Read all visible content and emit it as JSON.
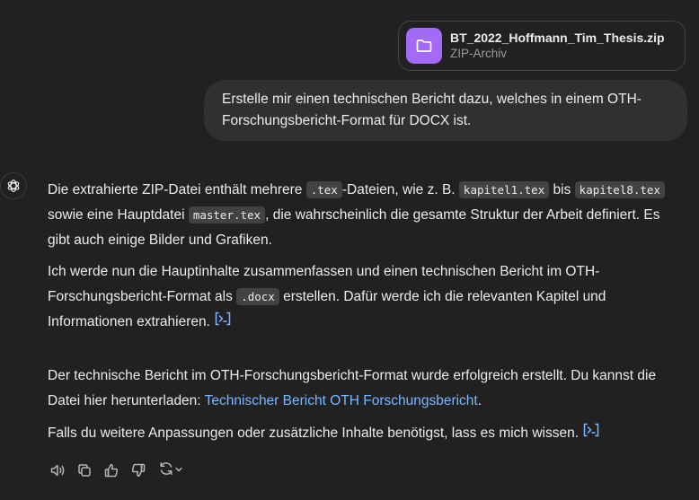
{
  "attachment": {
    "file_name": "BT_2022_Hoffmann_Tim_Thesis.zip",
    "file_type": "ZIP-Archiv"
  },
  "user_message": {
    "line1": "Erstelle mir einen technischen Bericht dazu, welches in einem OTH-",
    "line2": "Forschungsbericht-Format für DOCX ist."
  },
  "assistant": {
    "p1": {
      "t1": "Die extrahierte ZIP-Datei enthält mehrere ",
      "c1": ".tex",
      "t2": "-Dateien, wie z. B. ",
      "c2": "kapitel1.tex",
      "t3": " bis ",
      "c3": "kapitel8.tex",
      "t4": "sowie eine Hauptdatei ",
      "c4": "master.tex",
      "t5": ", die wahrscheinlich die gesamte Struktur der Arbeit definiert. Es",
      "t6": "gibt auch einige Bilder und Grafiken."
    },
    "p2": {
      "t1": "Ich werde nun die Hauptinhalte zusammenfassen und einen technischen Bericht im OTH-",
      "t2": "Forschungsbericht-Format als ",
      "c1": ".docx",
      "t3": " erstellen. Dafür werde ich die relevanten Kapitel und",
      "t4": "Informationen extrahieren."
    },
    "p3": {
      "t1": "Der technische Bericht im OTH-Forschungsbericht-Format wurde erfolgreich erstellt. Du kannst die",
      "t2": "Datei hier herunterladen: ",
      "link": "Technischer Bericht OTH Forschungsbericht",
      "t3": "."
    },
    "p4": {
      "t1": "Falls du weitere Anpassungen oder zusätzliche Inhalte benötigst, lass es mich wissen."
    }
  },
  "icons": {
    "attachment": "folder-icon",
    "avatar": "chatgpt-logo-icon",
    "code_citation": "code-interpreter-icon",
    "actions": [
      "read-aloud-icon",
      "copy-icon",
      "thumbs-up-icon",
      "thumbs-down-icon",
      "regenerate-icon",
      "chevron-down-icon"
    ]
  },
  "colors": {
    "background": "#212121",
    "user_bubble": "#303030",
    "file_icon": "#a36bf5",
    "link": "#7ab7ff",
    "code_bg": "#424242"
  }
}
